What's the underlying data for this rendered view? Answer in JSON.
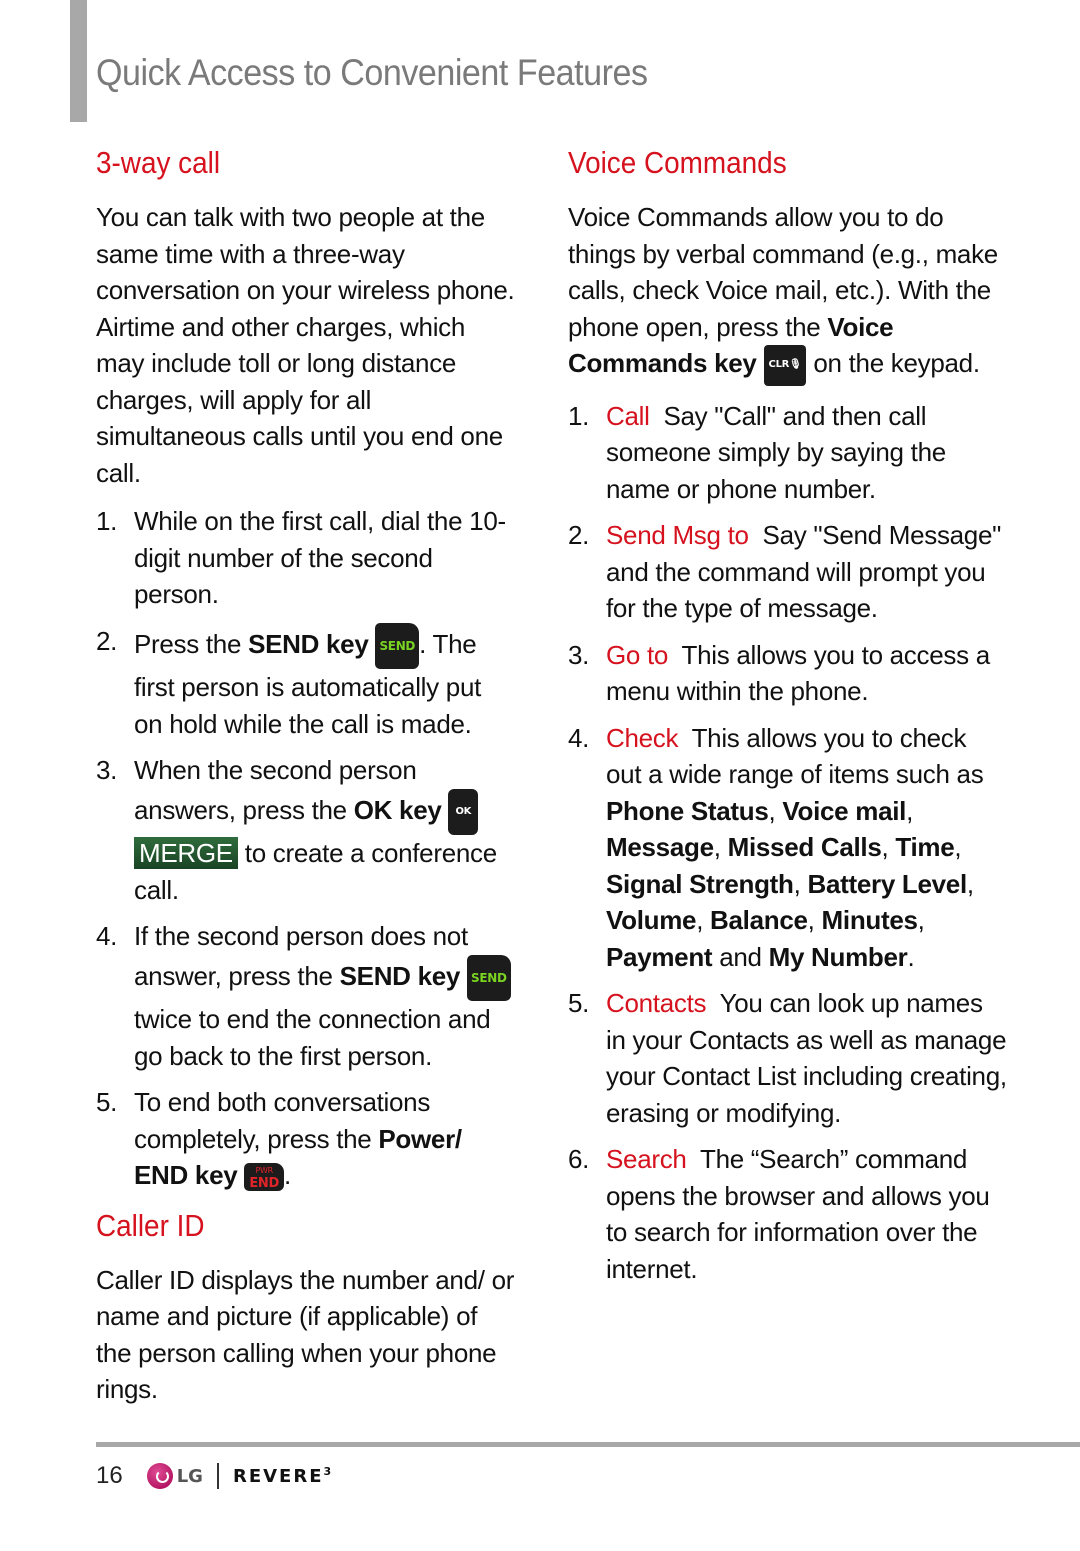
{
  "page": {
    "title": "Quick Access to Convenient Features",
    "number": "16",
    "brand": "LG",
    "model": "REVERE",
    "model_suffix": "3"
  },
  "left": {
    "threeway": {
      "heading": "3-way call",
      "intro": "You can talk with two people at the same time with a three-way conversation on your wireless phone. Airtime and other charges, which may include toll or long distance charges, will apply for all simultaneous calls until you end one call.",
      "steps": [
        {
          "num": "1.",
          "text": "While on the first call, dial the 10-digit number of the second person."
        },
        {
          "num": "2.",
          "pre": "Press the ",
          "bold": "SEND key",
          "key": "SEND",
          "post": ". The first person is automatically put on hold while the call is made."
        },
        {
          "num": "3.",
          "pre": "When the second person answers, press the ",
          "bold": "OK key",
          "key": "OK",
          "merge": "MERGE",
          "post": " to create a conference call."
        },
        {
          "num": "4.",
          "pre": "If the second person does not answer, press the ",
          "bold": "SEND key",
          "key": "SEND",
          "post": " twice to end the connection and go back to the first person."
        },
        {
          "num": "5.",
          "pre": "To end both conversations completely, press the ",
          "bold": "Power/ END key",
          "key_top": "PWR",
          "key": "END",
          "post": "."
        }
      ]
    },
    "callerid": {
      "heading": "Caller ID",
      "text": "Caller ID displays the number and/ or name and picture (if applicable) of the person calling when your phone rings."
    }
  },
  "right": {
    "voice": {
      "heading": "Voice Commands",
      "intro": "Voice Commands allow you to do things by verbal command (e.g., make calls, check Voice mail, etc.). With the phone open, press the ",
      "intro_bold": "Voice Commands key",
      "intro_key": "CLR",
      "intro_post": " on the keypad.",
      "steps": [
        {
          "num": "1.",
          "label": "Call",
          "text": "Say \"Call\" and then call someone simply by saying the name or phone number."
        },
        {
          "num": "2.",
          "label": "Send Msg to",
          "text": "Say \"Send Message\" and the command will prompt you for the type of message."
        },
        {
          "num": "3.",
          "label": "Go to",
          "text": "This allows you to access a menu within the phone."
        },
        {
          "num": "4.",
          "label": "Check",
          "text": "This allows you to check out a wide range of items such as ",
          "items": [
            "Phone Status",
            "Voice mail",
            "Message",
            "Missed Calls",
            "Time",
            "Signal Strength",
            "Battery Level",
            "Volume",
            "Balance",
            "Minutes",
            "Payment",
            "My Number"
          ]
        },
        {
          "num": "5.",
          "label": "Contacts",
          "text": "You can look up names in your Contacts as well as manage your Contact List including creating, erasing or modifying."
        },
        {
          "num": "6.",
          "label": "Search",
          "text": "The “Search” command opens the browser and allows you to search for information over the internet."
        }
      ]
    }
  }
}
